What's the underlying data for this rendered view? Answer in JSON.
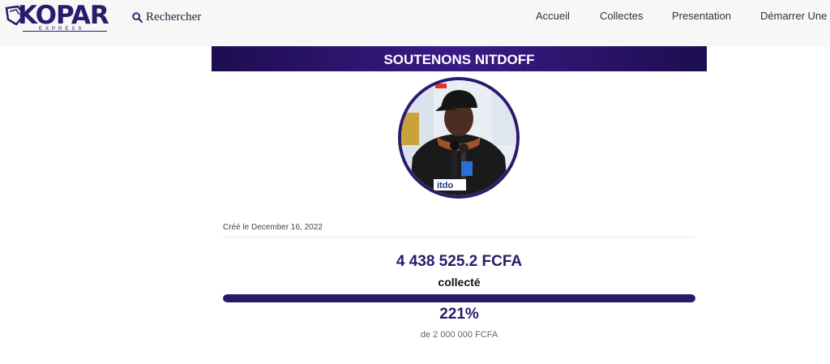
{
  "nav": {
    "logo_text": "KOPAR",
    "logo_sub": "EXPRESS",
    "search_label": "Rechercher",
    "links": [
      "Accueil",
      "Collectes",
      "Presentation",
      "Démarrer Une"
    ]
  },
  "campaign": {
    "title": "SOUTENONS NITDOFF",
    "created": "Créé le December 16, 2022",
    "amount": "4 438 525.2 FCFA",
    "collected_label": "collecté",
    "percent": "221%",
    "progress_fraction": 1.0,
    "goal": "de 2 000 000 FCFA"
  },
  "colors": {
    "brand": "#2b1a6b",
    "banner_dark": "#1d0d50"
  }
}
